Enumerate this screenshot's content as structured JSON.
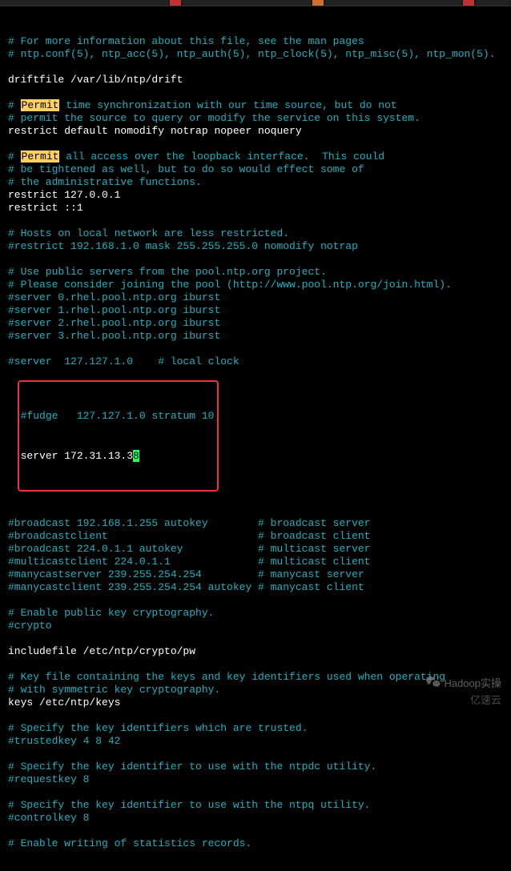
{
  "highlight_word": "Permit",
  "lines": [
    {
      "cls": "comment",
      "t": "# For more information about this file, see the man pages"
    },
    {
      "cls": "comment",
      "t": "# ntp.conf(5), ntp_acc(5), ntp_auth(5), ntp_clock(5), ntp_misc(5), ntp_mon(5)."
    },
    {
      "cls": "blank",
      "t": ""
    },
    {
      "cls": "active",
      "t": "driftfile /var/lib/ntp/drift"
    },
    {
      "cls": "blank",
      "t": ""
    },
    {
      "cls": "comment-hl",
      "prefix": "# ",
      "hl": "Permit",
      "suffix": " time synchronization with our time source, but do not"
    },
    {
      "cls": "comment",
      "t": "# permit the source to query or modify the service on this system."
    },
    {
      "cls": "active",
      "t": "restrict default nomodify notrap nopeer noquery"
    },
    {
      "cls": "blank",
      "t": ""
    },
    {
      "cls": "comment-hl",
      "prefix": "# ",
      "hl": "Permit",
      "suffix": " all access over the loopback interface.  This could"
    },
    {
      "cls": "comment",
      "t": "# be tightened as well, but to do so would effect some of"
    },
    {
      "cls": "comment",
      "t": "# the administrative functions."
    },
    {
      "cls": "active",
      "t": "restrict 127.0.0.1"
    },
    {
      "cls": "active",
      "t": "restrict ::1"
    },
    {
      "cls": "blank",
      "t": ""
    },
    {
      "cls": "comment",
      "t": "# Hosts on local network are less restricted."
    },
    {
      "cls": "comment",
      "t": "#restrict 192.168.1.0 mask 255.255.255.0 nomodify notrap"
    },
    {
      "cls": "blank",
      "t": ""
    },
    {
      "cls": "comment",
      "t": "# Use public servers from the pool.ntp.org project."
    },
    {
      "cls": "comment",
      "t": "# Please consider joining the pool (http://www.pool.ntp.org/join.html)."
    },
    {
      "cls": "comment",
      "t": "#server 0.rhel.pool.ntp.org iburst"
    },
    {
      "cls": "comment",
      "t": "#server 1.rhel.pool.ntp.org iburst"
    },
    {
      "cls": "comment",
      "t": "#server 2.rhel.pool.ntp.org iburst"
    },
    {
      "cls": "comment",
      "t": "#server 3.rhel.pool.ntp.org iburst"
    },
    {
      "cls": "blank",
      "t": ""
    },
    {
      "cls": "comment",
      "t": "#server  127.127.1.0    # local clock"
    }
  ],
  "boxed": {
    "line1": "#fudge   127.127.1.0 stratum 10",
    "line2_prefix": "server 172.31.13.3",
    "line2_cursor": "8"
  },
  "lines_after": [
    {
      "cls": "blank",
      "t": ""
    },
    {
      "cls": "comment",
      "t": "#broadcast 192.168.1.255 autokey        # broadcast server"
    },
    {
      "cls": "comment",
      "t": "#broadcastclient                        # broadcast client"
    },
    {
      "cls": "comment",
      "t": "#broadcast 224.0.1.1 autokey            # multicast server"
    },
    {
      "cls": "comment",
      "t": "#multicastclient 224.0.1.1              # multicast client"
    },
    {
      "cls": "comment",
      "t": "#manycastserver 239.255.254.254         # manycast server"
    },
    {
      "cls": "comment",
      "t": "#manycastclient 239.255.254.254 autokey # manycast client"
    },
    {
      "cls": "blank",
      "t": ""
    },
    {
      "cls": "comment",
      "t": "# Enable public key cryptography."
    },
    {
      "cls": "comment",
      "t": "#crypto"
    },
    {
      "cls": "blank",
      "t": ""
    },
    {
      "cls": "active",
      "t": "includefile /etc/ntp/crypto/pw"
    },
    {
      "cls": "blank",
      "t": ""
    },
    {
      "cls": "comment",
      "t": "# Key file containing the keys and key identifiers used when operating"
    },
    {
      "cls": "comment",
      "t": "# with symmetric key cryptography."
    },
    {
      "cls": "active",
      "t": "keys /etc/ntp/keys"
    },
    {
      "cls": "blank",
      "t": ""
    },
    {
      "cls": "comment",
      "t": "# Specify the key identifiers which are trusted."
    },
    {
      "cls": "comment",
      "t": "#trustedkey 4 8 42"
    },
    {
      "cls": "blank",
      "t": ""
    },
    {
      "cls": "comment",
      "t": "# Specify the key identifier to use with the ntpdc utility."
    },
    {
      "cls": "comment",
      "t": "#requestkey 8"
    },
    {
      "cls": "blank",
      "t": ""
    },
    {
      "cls": "comment",
      "t": "# Specify the key identifier to use with the ntpq utility."
    },
    {
      "cls": "comment",
      "t": "#controlkey 8"
    },
    {
      "cls": "blank",
      "t": ""
    },
    {
      "cls": "comment",
      "t": "# Enable writing of statistics records."
    }
  ],
  "watermark1": "Hadoop实操",
  "watermark2": "亿速云"
}
